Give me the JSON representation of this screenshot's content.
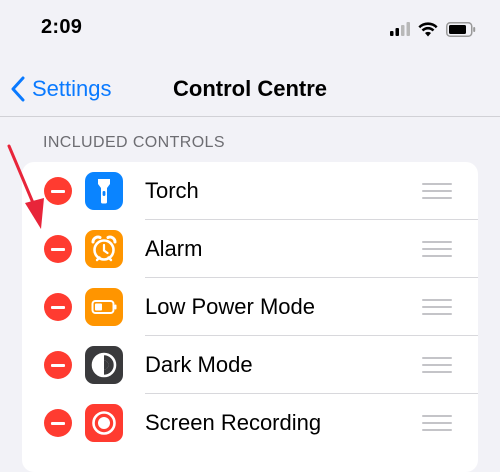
{
  "status_bar": {
    "time": "2:09",
    "icons": [
      "cellular-signal-icon",
      "wifi-icon",
      "battery-icon"
    ]
  },
  "nav": {
    "back_label": "Settings",
    "back_icon": "chevron-left-icon",
    "title": "Control Centre"
  },
  "section": {
    "header": "INCLUDED CONTROLS"
  },
  "controls": [
    {
      "label": "Torch",
      "icon": "torch-icon",
      "color": "#0a84ff"
    },
    {
      "label": "Alarm",
      "icon": "alarm-icon",
      "color": "#ff9500"
    },
    {
      "label": "Low Power Mode",
      "icon": "battery-icon",
      "color": "#ff9500"
    },
    {
      "label": "Dark Mode",
      "icon": "dark-mode-icon",
      "color": "#3a3a3c"
    },
    {
      "label": "Screen Recording",
      "icon": "screen-recording-icon",
      "color": "#ff3b30"
    }
  ],
  "colors": {
    "accent": "#0a7aff",
    "remove": "#ff3b30",
    "annotation_arrow": "#e8253a"
  }
}
